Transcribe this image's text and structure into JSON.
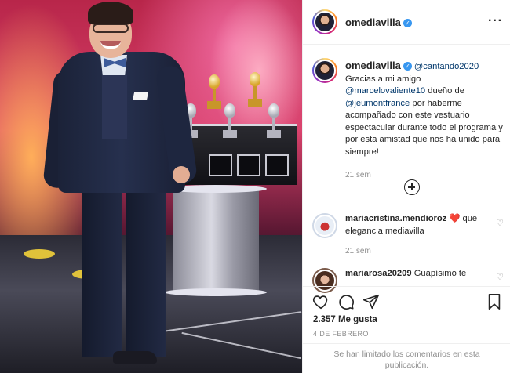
{
  "post": {
    "username": "omediavilla",
    "verified_icon": "check-icon"
  },
  "caption": {
    "username": "omediavilla",
    "mention_1": "@cantando2020",
    "text_1": "Gracias a mi amigo",
    "mention_2": "@marcelovaliente10",
    "text_2": "dueño de",
    "mention_3": "@jeumontfrance",
    "text_3": "por haberme acompañado con este vestuario espectacular durante todo el programa y por esta amistad que nos ha unido para siempre!",
    "time": "21 sem"
  },
  "comments": [
    {
      "username": "mariacristina.mendioroz",
      "emoji": "❤️",
      "text": "que elegancia mediavilla",
      "time": "21 sem"
    },
    {
      "username": "mariarosa20209",
      "text": "Guapísimo te"
    }
  ],
  "actions": {
    "likes": "2.357 Me gusta",
    "date": "4 DE FEBRERO",
    "comments_disabled": "Se han limitado los comentarios en esta publicación."
  },
  "colors": {
    "link": "#00376b",
    "verified": "#3897f0",
    "muted": "#8e8e8e",
    "heart": "#ed4956"
  }
}
